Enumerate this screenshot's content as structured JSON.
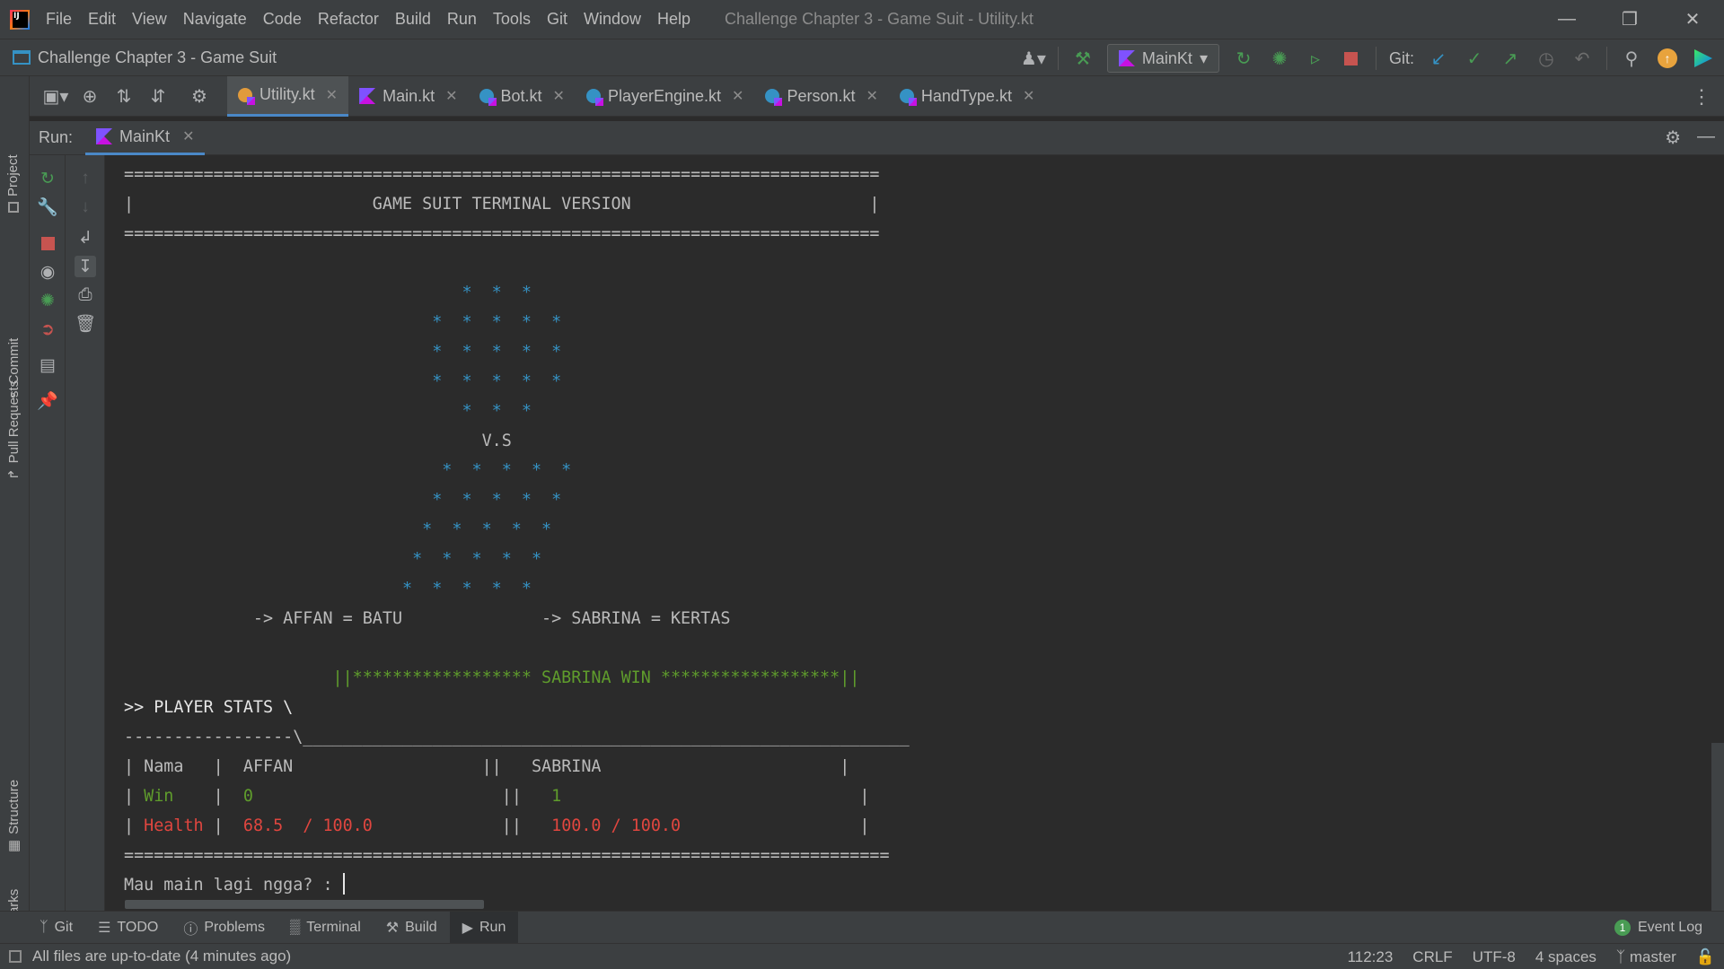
{
  "menu": [
    "File",
    "Edit",
    "View",
    "Navigate",
    "Code",
    "Refactor",
    "Build",
    "Run",
    "Tools",
    "Git",
    "Window",
    "Help"
  ],
  "window_title": "Challenge Chapter 3 - Game Suit - Utility.kt",
  "project_name": "Challenge Chapter 3 - Game Suit",
  "run_config": "MainKt",
  "git_label": "Git:",
  "left_strip": [
    "Project",
    "Commit",
    "Pull Requests",
    "Structure",
    "Bookmarks"
  ],
  "editor_tabs": [
    {
      "label": "Utility.kt",
      "active": true
    },
    {
      "label": "Main.kt",
      "active": false
    },
    {
      "label": "Bot.kt",
      "active": false
    },
    {
      "label": "PlayerEngine.kt",
      "active": false
    },
    {
      "label": "Person.kt",
      "active": false
    },
    {
      "label": "HandType.kt",
      "active": false
    }
  ],
  "run_panel": {
    "label": "Run:",
    "tab": "MainKt"
  },
  "console": {
    "banner_line": "============================================================================",
    "banner_title": "|                        GAME SUIT TERMINAL VERSION                        |",
    "art_rows": [
      "                                  *  *  *",
      "                               *  *  *  *  *",
      "                               *  *  *  *  *",
      "                               *  *  *  *  *",
      "                                  *  *  *",
      "                                    V.S",
      "                                *  *  *  *  *",
      "                               *  *  *  *  *",
      "                              *  *  *  *  *",
      "                             *  *  *  *  *",
      "                            *  *  *  *  *"
    ],
    "choices": "             -> AFFAN = BATU              -> SABRINA = KERTAS",
    "winner": "                     ||****************** SABRINA WIN ******************||",
    "stats_header": ">> PLAYER STATS \\",
    "stats_divider": "-----------------\\_____________________________________________________________",
    "row_name_label": "| Nama   |",
    "row_name_p1": "  AFFAN                   ||   ",
    "row_name_p2": "SABRINA                        |",
    "row_win_label": "Win",
    "row_win_p1": "0",
    "row_win_p2": "1",
    "row_health_label": "Health",
    "row_health_p1": "68.5  / 100.0",
    "row_health_p2": "100.0 / 100.0",
    "bottom_line": "=============================================================================",
    "prompt": "Mau main lagi ngga? : "
  },
  "bottom_tabs": [
    "Git",
    "TODO",
    "Problems",
    "Terminal",
    "Build",
    "Run"
  ],
  "event_log": {
    "label": "Event Log",
    "count": "1"
  },
  "status": {
    "message": "All files are up-to-date (4 minutes ago)",
    "position": "112:23",
    "line_sep": "CRLF",
    "encoding": "UTF-8",
    "indent": "4 spaces",
    "branch": "master"
  },
  "colors": {
    "accent": "#4a88c7",
    "green": "#5f9c2c",
    "red": "#e0463f",
    "blue": "#3592c4"
  }
}
